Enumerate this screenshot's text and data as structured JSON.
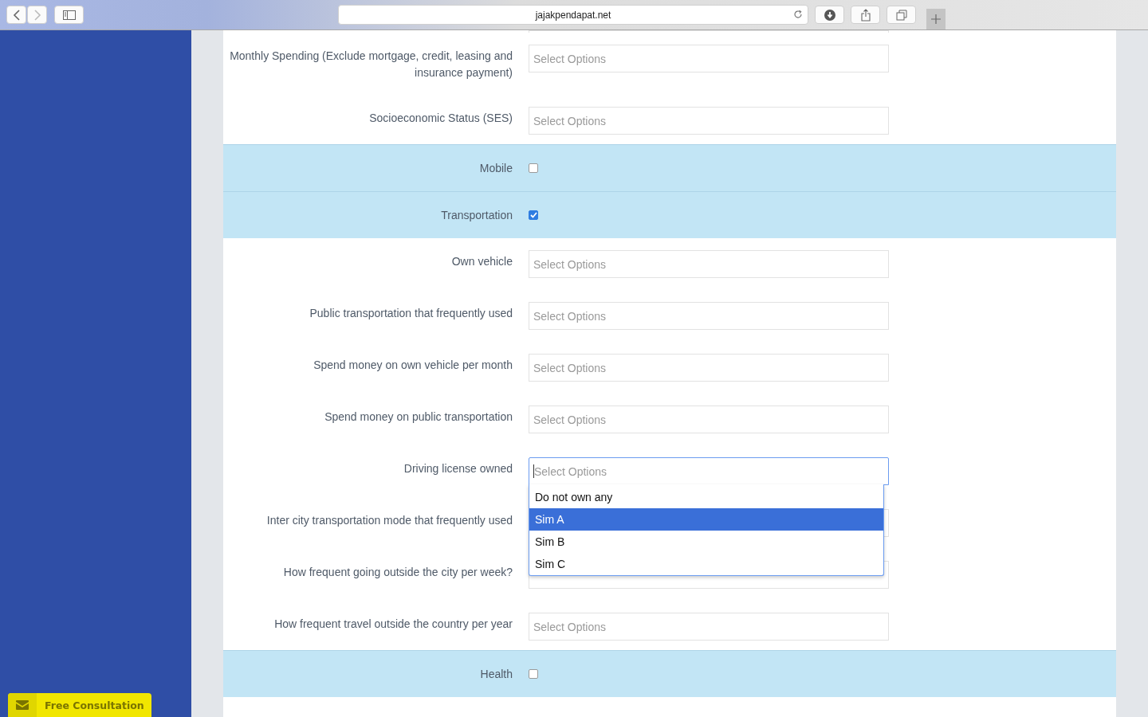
{
  "browser": {
    "url": "jajakpendapat.net"
  },
  "form_rows": [
    {
      "kind": "cut"
    },
    {
      "kind": "select",
      "label": "Monthly Spending (Exclude mortgage, credit, leasing and insurance payment)",
      "placeholder": "Select Options",
      "open": false
    },
    {
      "kind": "select",
      "label": "Socioeconomic Status (SES)",
      "placeholder": "Select Options",
      "open": false
    },
    {
      "kind": "checkbox",
      "label": "Mobile",
      "checked": false
    },
    {
      "kind": "checkbox",
      "label": "Transportation",
      "checked": true
    },
    {
      "kind": "select",
      "label": "Own vehicle",
      "placeholder": "Select Options",
      "open": false
    },
    {
      "kind": "select",
      "label": "Public transportation that frequently used",
      "placeholder": "Select Options",
      "open": false
    },
    {
      "kind": "select",
      "label": "Spend money on own vehicle per month",
      "placeholder": "Select Options",
      "open": false
    },
    {
      "kind": "select",
      "label": "Spend money on public transportation",
      "placeholder": "Select Options",
      "open": false
    },
    {
      "kind": "select",
      "label": "Driving license owned",
      "placeholder": "Select Options",
      "open": true,
      "options": [
        {
          "label": "Do not own any",
          "selected": false
        },
        {
          "label": "Sim A",
          "selected": true
        },
        {
          "label": "Sim B",
          "selected": false
        },
        {
          "label": "Sim C",
          "selected": false
        }
      ]
    },
    {
      "kind": "select",
      "label": "Inter city transportation mode that frequently used",
      "open": false
    },
    {
      "kind": "select",
      "label": "How frequent going outside the city per week?",
      "open": false
    },
    {
      "kind": "select",
      "label": "How frequent travel outside the country per year",
      "placeholder": "Select Options",
      "open": false
    },
    {
      "kind": "checkbox",
      "label": "Health",
      "checked": false
    }
  ],
  "consult_button": {
    "label": "Free Consultation"
  }
}
